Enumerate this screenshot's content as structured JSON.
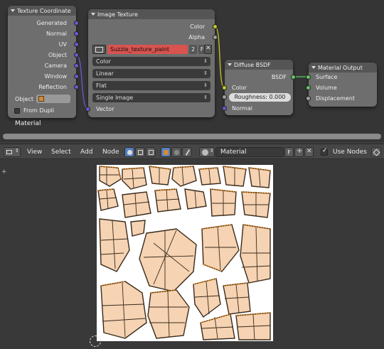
{
  "nodes": {
    "texture_coordinate": {
      "title": "Texture Coordinate",
      "outputs": [
        "Generated",
        "Normal",
        "UV",
        "Object",
        "Camera",
        "Window",
        "Reflection"
      ],
      "object_label": "Object",
      "from_dupli_label": "From Dupli"
    },
    "image_texture": {
      "title": "Image Texture",
      "outputs": [
        "Color",
        "Alpha"
      ],
      "image_name": "Suzzie_texture_paint",
      "users_count": "2",
      "fake_user": "F",
      "color_space": "Color",
      "interpolation": "Linear",
      "projection": "Flat",
      "source": "Single Image",
      "input_vector": "Vector"
    },
    "diffuse_bsdf": {
      "title": "Diffuse BSDF",
      "output": "BSDF",
      "input_color": "Color",
      "roughness": "Roughness: 0.000",
      "input_normal": "Normal"
    },
    "material_output": {
      "title": "Material Output",
      "inputs": [
        "Surface",
        "Volume",
        "Displacement"
      ]
    }
  },
  "frame_label": "Material",
  "header": {
    "menus": [
      "View",
      "Select",
      "Add",
      "Node"
    ],
    "material_name": "Material",
    "fake_user": "F",
    "use_nodes_label": "Use Nodes"
  },
  "colors": {
    "uv_face_fill": "#f5d3b3",
    "uv_edge": "#3a2a1a",
    "uv_selected_edge": "#ff8c00",
    "image_field_red": "#d9534f"
  }
}
